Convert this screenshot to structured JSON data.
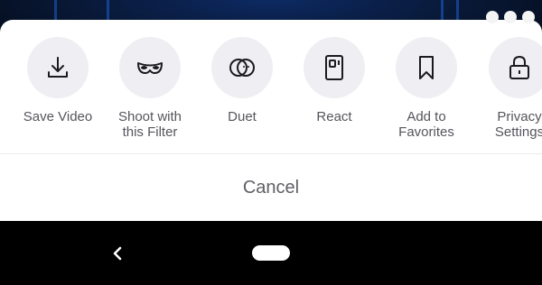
{
  "share_sheet": {
    "actions": [
      {
        "label": "Save Video",
        "icon": "download-icon"
      },
      {
        "label": "Shoot with\nthis Filter",
        "icon": "mask-icon"
      },
      {
        "label": "Duet",
        "icon": "duet-icon"
      },
      {
        "label": "React",
        "icon": "react-icon"
      },
      {
        "label": "Add to\nFavorites",
        "icon": "bookmark-icon"
      },
      {
        "label": "Privacy\nSettings",
        "icon": "lock-icon"
      }
    ],
    "cancel_label": "Cancel"
  },
  "colors": {
    "sheet_background": "#ffffff",
    "icon_circle": "#efeef2",
    "text": "#55555c",
    "nav_bar": "#000000"
  }
}
